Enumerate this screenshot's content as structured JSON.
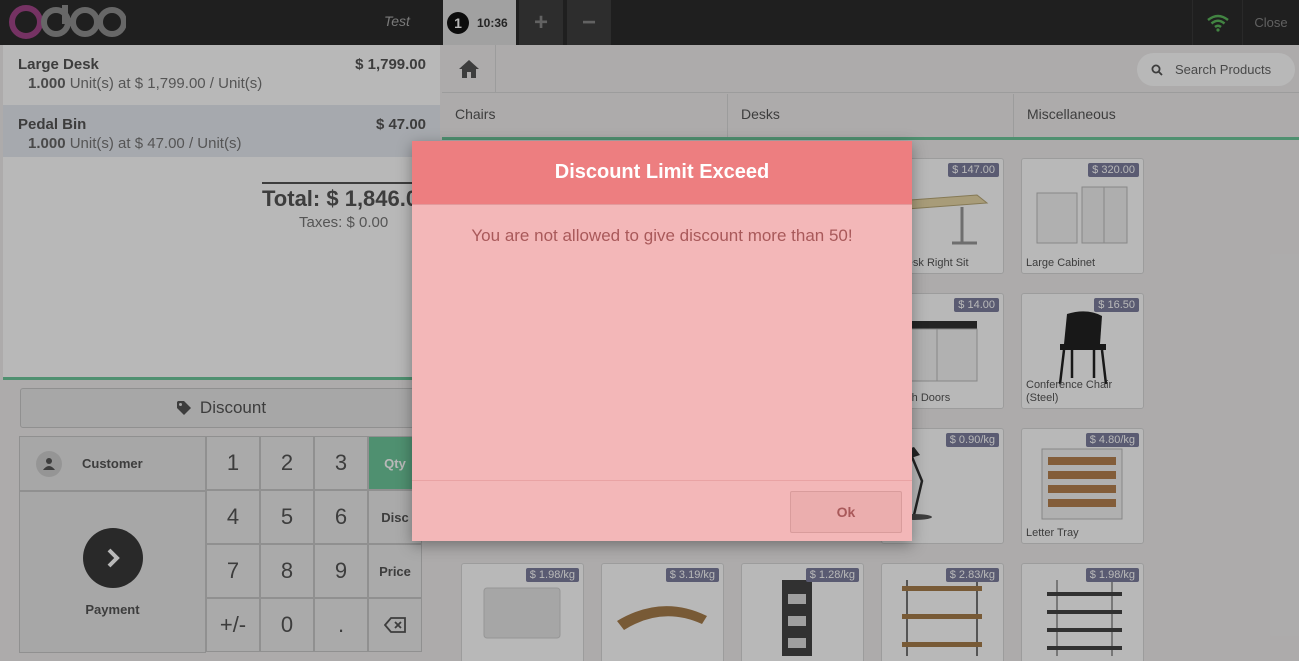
{
  "topbar": {
    "logo_text": "odoo",
    "shop_name": "Test",
    "order": {
      "number": "1",
      "time": "10:36"
    },
    "add_order_symbol": "+",
    "remove_order_symbol": "−",
    "wifi_color": "#5cb85c",
    "close_label": "Close"
  },
  "orderlines": [
    {
      "name": "Large Desk",
      "price": "$ 1,799.00",
      "qty": "1.000",
      "info": "Unit(s) at $ 1,799.00 / Unit(s)"
    },
    {
      "name": "Pedal Bin",
      "price": "$ 47.00",
      "qty": "1.000",
      "info": "Unit(s) at $ 47.00 / Unit(s)"
    }
  ],
  "summary": {
    "total": "Total: $ 1,846.0",
    "taxes": "Taxes: $ 0.00"
  },
  "controls": {
    "discount_label": "Discount",
    "customer_label": "Customer",
    "payment_label": "Payment",
    "keys": [
      "1",
      "2",
      "3",
      "4",
      "5",
      "6",
      "7",
      "8",
      "9",
      "+/-",
      "0",
      "."
    ],
    "mode_qty": "Qty",
    "mode_disc": "Disc",
    "mode_price": "Price",
    "accent_color": "#6ec89b"
  },
  "products_header": {
    "search_placeholder": "Search Products",
    "categories": [
      "Chairs",
      "Desks",
      "Miscellaneous"
    ]
  },
  "products": [
    {
      "price": "$ 147.00",
      "name": "er Desk Right Sit"
    },
    {
      "price": "$ 320.00",
      "name": "Large Cabinet"
    },
    {
      "price": "$ 14.00",
      "name": "et with Doors"
    },
    {
      "price": "$ 16.50",
      "name": "Conference Chair (Steel)"
    },
    {
      "price": "$ 0.90/kg",
      "name": "amp"
    },
    {
      "price": "$ 4.80/kg",
      "name": "Letter Tray"
    },
    {
      "price": "$ 1.98/kg",
      "name": ""
    },
    {
      "price": "$ 3.19/kg",
      "name": ""
    },
    {
      "price": "$ 1.28/kg",
      "name": ""
    },
    {
      "price": "$ 2.83/kg",
      "name": ""
    },
    {
      "price": "$ 1.98/kg",
      "name": ""
    }
  ],
  "dialog": {
    "title": "Discount Limit Exceed",
    "message": "You are not allowed to give discount more than 50!",
    "ok_label": "Ok",
    "header_color": "#ed7e80",
    "body_color": "#f3b7b8"
  }
}
